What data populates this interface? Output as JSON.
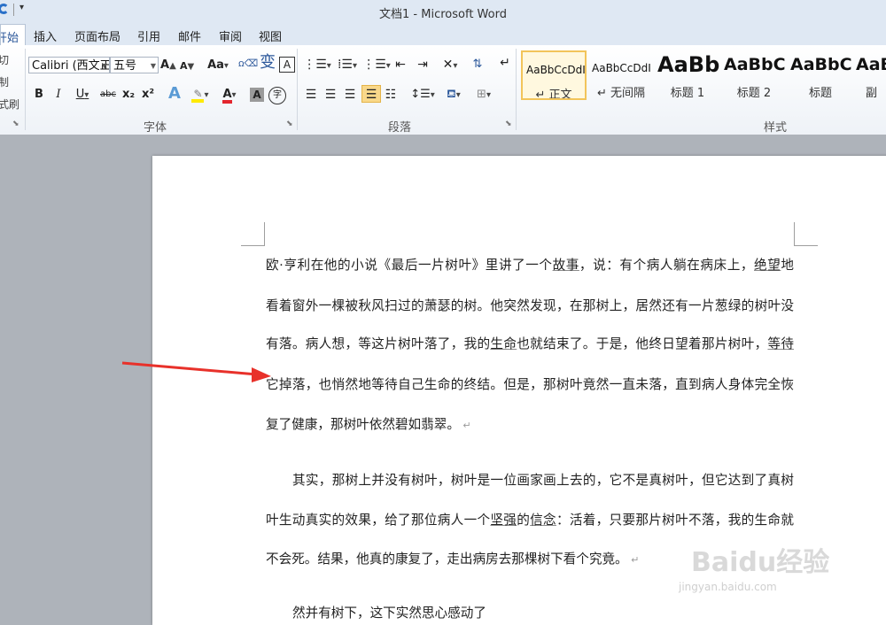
{
  "window": {
    "title": "文档1 - Microsoft Word"
  },
  "tabs": [
    {
      "label": "开始",
      "active": true
    },
    {
      "label": "插入"
    },
    {
      "label": "页面布局"
    },
    {
      "label": "引用"
    },
    {
      "label": "邮件"
    },
    {
      "label": "审阅"
    },
    {
      "label": "视图"
    }
  ],
  "clipboard": {
    "cut": "切",
    "copy": "制",
    "painter": "式刷"
  },
  "font": {
    "family": "Calibri (西文正",
    "size": "五号",
    "group_label": "字体",
    "grow_label": "A",
    "shrink_label": "A",
    "case_label": "Aa",
    "bold": "B",
    "italic": "I",
    "underline": "U",
    "strike": "abc",
    "subscript": "x₂",
    "superscript": "x²",
    "font_color": "A",
    "phonetic": "变",
    "char_border": "A",
    "char_shade": "A",
    "enclose": "字"
  },
  "paragraph": {
    "group_label": "段落"
  },
  "styles": {
    "group_label": "样式",
    "items": [
      {
        "sample": "AaBbCcDdI",
        "name": "↵ 正文"
      },
      {
        "sample": "AaBbCcDdI",
        "name": "↵ 无间隔"
      },
      {
        "sample": "AaBb",
        "name": "标题 1"
      },
      {
        "sample": "AaBbC",
        "name": "标题 2"
      },
      {
        "sample": "AaBbC",
        "name": "标题"
      },
      {
        "sample": "AaB",
        "name": "副标"
      }
    ]
  },
  "document": {
    "lines": [
      [
        "欧·亨利在他的小说《最后一片树叶》里讲了一个",
        "故事",
        "，说：有个病人躺在病床上，",
        "绝望",
        "地"
      ],
      [
        "看着窗外一棵被秋风扫过的萧瑟的树。他突然发现，在那树上，居然还有一片葱绿的树叶没"
      ],
      [
        "有落。病人想，等这片树叶落了，我的",
        "生命",
        "也就结束了。于是，他终日望着那片树叶，",
        "等待",
        ""
      ],
      [
        "它掉落，也悄然地等待自己生命的终结。但是，那树叶竟然一直未落，直到病人身体完全恢"
      ],
      [
        "复了健康，那树叶依然碧如翡翠。"
      ],
      [
        "其实，那树上并没有树叶，树叶是一位画家画上去的，它不是真树叶，但它达到了真树"
      ],
      [
        "叶生动真实的效果，给了那位病人一个",
        "坚强",
        "的",
        "信念",
        "：活着，只要那片树叶不落，我的生命就"
      ],
      [
        "不会死。结果，他真的康复了，走出病房去那棵树下看个究竟。"
      ],
      [
        "然并有树下，这下实然思心感动了"
      ]
    ],
    "para_mark": "↵"
  },
  "watermark": {
    "brand": "Baidu经验",
    "url": "jingyan.baidu.com"
  },
  "colors": {
    "arrow": "#e8312a",
    "highlight": "#f2c45a",
    "accent": "#2b579a"
  }
}
